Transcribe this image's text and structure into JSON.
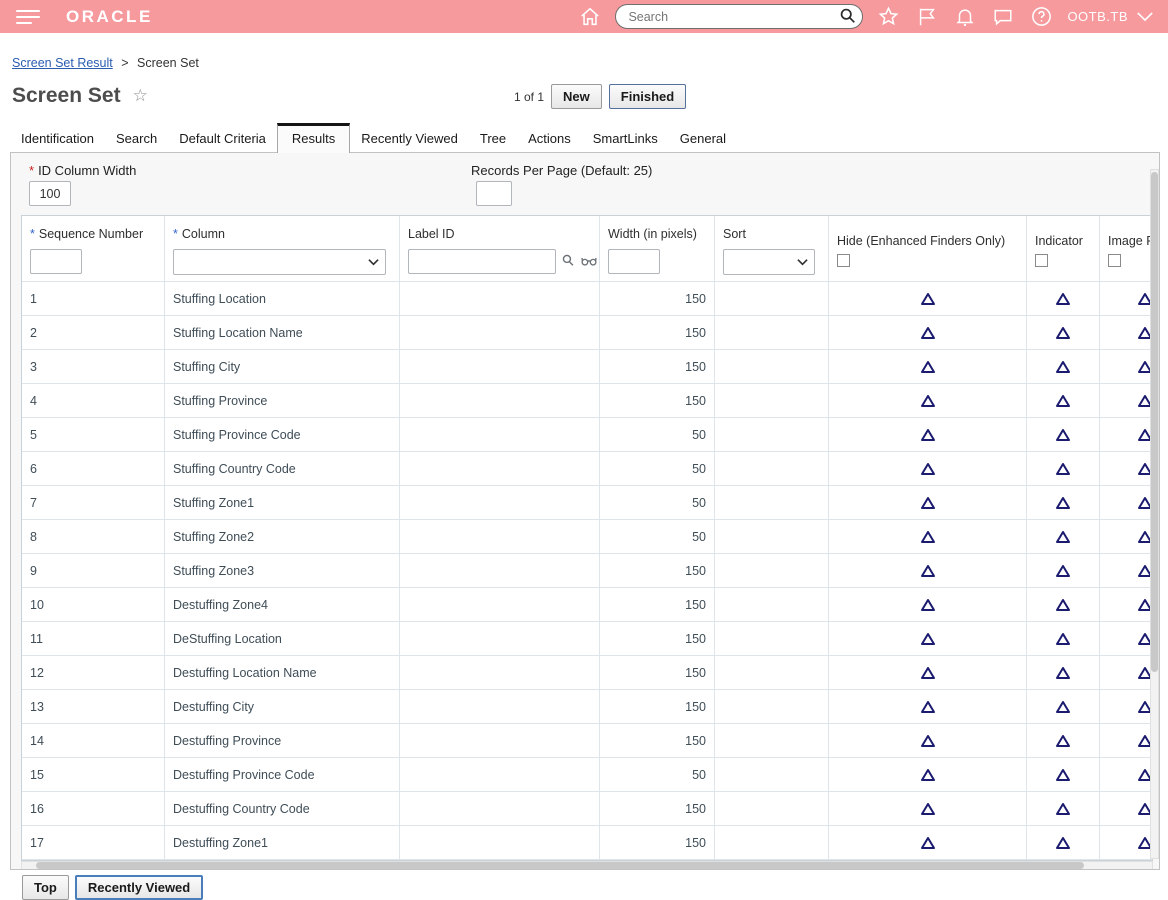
{
  "required_marker": "*",
  "colors": {
    "topbar_pink": "#f69a9e",
    "link_blue": "#2a5db0",
    "triangle_navy": "#1b1b6f",
    "required_red": "#cc2222",
    "required_blue": "#3366cc"
  },
  "header": {
    "logo": "ORACLE",
    "search_placeholder": "Search",
    "user": "OOTB.TB",
    "icons": [
      "hamburger-menu",
      "home",
      "search",
      "favorites-star",
      "flag",
      "notifications-bell",
      "chat",
      "help",
      "chevron-down"
    ]
  },
  "breadcrumb": {
    "link": "Screen Set Result",
    "separator": ">",
    "current": "Screen Set"
  },
  "page": {
    "title": "Screen Set",
    "favorite_icon": "☆",
    "record_count": "1 of 1",
    "actions": {
      "new": "New",
      "finished": "Finished"
    }
  },
  "tabs": {
    "items": [
      "Identification",
      "Search",
      "Default Criteria",
      "Results",
      "Recently Viewed",
      "Tree",
      "Actions",
      "SmartLinks",
      "General"
    ],
    "active": "Results"
  },
  "form": {
    "id_column_width": {
      "label": "ID Column Width",
      "required": true,
      "value": "100"
    },
    "records_per_page": {
      "label": "Records Per Page (Default: 25)",
      "value": ""
    }
  },
  "table": {
    "columns": [
      {
        "label": "Sequence Number",
        "required": true,
        "filter": "text"
      },
      {
        "label": "Column",
        "required": true,
        "filter": "select"
      },
      {
        "label": "Label ID",
        "required": false,
        "filter": "text-with-lookup"
      },
      {
        "label": "Width (in pixels)",
        "required": false,
        "filter": "text"
      },
      {
        "label": "Sort",
        "required": false,
        "filter": "select"
      },
      {
        "label": "Hide (Enhanced Finders Only)",
        "required": false,
        "filter": "checkbox"
      },
      {
        "label": "Indicator",
        "required": false,
        "filter": "checkbox"
      },
      {
        "label": "Image Pa",
        "required": false,
        "filter": "checkbox"
      }
    ],
    "rows": [
      {
        "seq": "1",
        "column": "Stuffing Location",
        "label_id": "",
        "width": "150",
        "sort": ""
      },
      {
        "seq": "2",
        "column": "Stuffing Location Name",
        "label_id": "",
        "width": "150",
        "sort": ""
      },
      {
        "seq": "3",
        "column": "Stuffing City",
        "label_id": "",
        "width": "150",
        "sort": ""
      },
      {
        "seq": "4",
        "column": "Stuffing Province",
        "label_id": "",
        "width": "150",
        "sort": ""
      },
      {
        "seq": "5",
        "column": "Stuffing Province Code",
        "label_id": "",
        "width": "50",
        "sort": ""
      },
      {
        "seq": "6",
        "column": "Stuffing Country Code",
        "label_id": "",
        "width": "50",
        "sort": ""
      },
      {
        "seq": "7",
        "column": "Stuffing Zone1",
        "label_id": "",
        "width": "50",
        "sort": ""
      },
      {
        "seq": "8",
        "column": "Stuffing Zone2",
        "label_id": "",
        "width": "50",
        "sort": ""
      },
      {
        "seq": "9",
        "column": "Stuffing Zone3",
        "label_id": "",
        "width": "150",
        "sort": ""
      },
      {
        "seq": "10",
        "column": "Destuffing Zone4",
        "label_id": "",
        "width": "150",
        "sort": ""
      },
      {
        "seq": "11",
        "column": "DeStuffing Location",
        "label_id": "",
        "width": "150",
        "sort": ""
      },
      {
        "seq": "12",
        "column": "Destuffing Location Name",
        "label_id": "",
        "width": "150",
        "sort": ""
      },
      {
        "seq": "13",
        "column": "Destuffing City",
        "label_id": "",
        "width": "150",
        "sort": ""
      },
      {
        "seq": "14",
        "column": "Destuffing Province",
        "label_id": "",
        "width": "150",
        "sort": ""
      },
      {
        "seq": "15",
        "column": "Destuffing Province Code",
        "label_id": "",
        "width": "50",
        "sort": ""
      },
      {
        "seq": "16",
        "column": "Destuffing Country Code",
        "label_id": "",
        "width": "150",
        "sort": ""
      },
      {
        "seq": "17",
        "column": "Destuffing Zone1",
        "label_id": "",
        "width": "150",
        "sort": ""
      }
    ]
  },
  "footer": {
    "top": "Top",
    "recently_viewed": "Recently Viewed"
  }
}
